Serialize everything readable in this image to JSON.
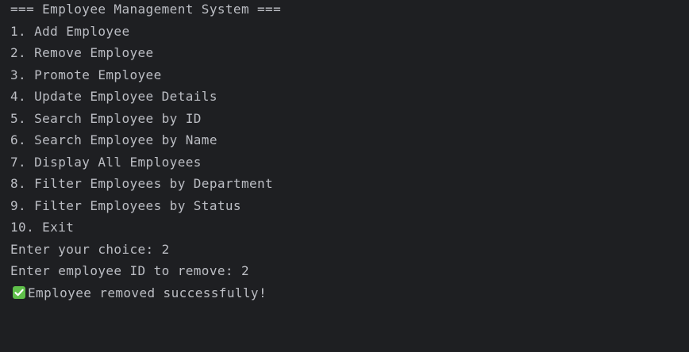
{
  "console": {
    "header": "=== Employee Management System ===",
    "menu": [
      "1. Add Employee",
      "2. Remove Employee",
      "3. Promote Employee",
      "4. Update Employee Details",
      "5. Search Employee by ID",
      "6. Search Employee by Name",
      "7. Display All Employees",
      "8. Filter Employees by Department",
      "9. Filter Employees by Status",
      "10. Exit"
    ],
    "choice_prompt": "Enter your choice: 2",
    "id_prompt": "Enter employee ID to remove: 2",
    "result_icon": "check-mark-icon",
    "result_message": "Employee removed successfully!",
    "colors": {
      "background": "#1e1f22",
      "text": "#bcbec4",
      "success_icon": "#5fbf4a"
    }
  }
}
